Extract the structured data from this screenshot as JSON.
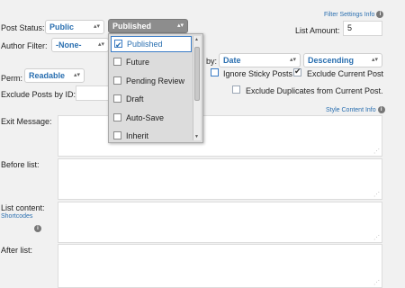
{
  "filter_settings": {
    "link": "Filter Settings Info",
    "icon": "info-icon"
  },
  "post_status": {
    "label": "Post Status:",
    "value": "Public",
    "dropdown_value": "Published"
  },
  "amount": {
    "label": "List Amount:",
    "value": "5"
  },
  "author": {
    "label": "Author Filter:",
    "value": "-None-"
  },
  "order": {
    "label_fragment": "by:",
    "orderby_value": "Date",
    "order_value": "Descending"
  },
  "perm": {
    "label": "Perm:",
    "value": "Readable"
  },
  "ignore_sticky": {
    "label": "Ignore Sticky Posts",
    "checked": false
  },
  "exclude_current": {
    "label": "Exclude Current Post",
    "checked": true
  },
  "exclude_dupes": {
    "label": "Exclude Duplicates from Current Post.",
    "checked": false
  },
  "exclude_ids": {
    "label": "Exclude Posts by ID:",
    "value": ""
  },
  "style_content": {
    "link": "Style Content Info",
    "icon": "info-icon"
  },
  "exit_message": {
    "label": "Exit Message:"
  },
  "before_list": {
    "label": "Before list:"
  },
  "list_content": {
    "label": "List content:",
    "shortcodes_link": "Shortcodes",
    "icon": "info-icon"
  },
  "after_list": {
    "label": "After list:"
  },
  "status_options": [
    {
      "label": "Published",
      "checked": true
    },
    {
      "label": "Future",
      "checked": false
    },
    {
      "label": "Pending Review",
      "checked": false
    },
    {
      "label": "Draft",
      "checked": false
    },
    {
      "label": "Auto-Save",
      "checked": false
    },
    {
      "label": "Inherit",
      "checked": false
    }
  ],
  "colors": {
    "link": "#2a6fb0",
    "background": "#f1f1f1"
  }
}
